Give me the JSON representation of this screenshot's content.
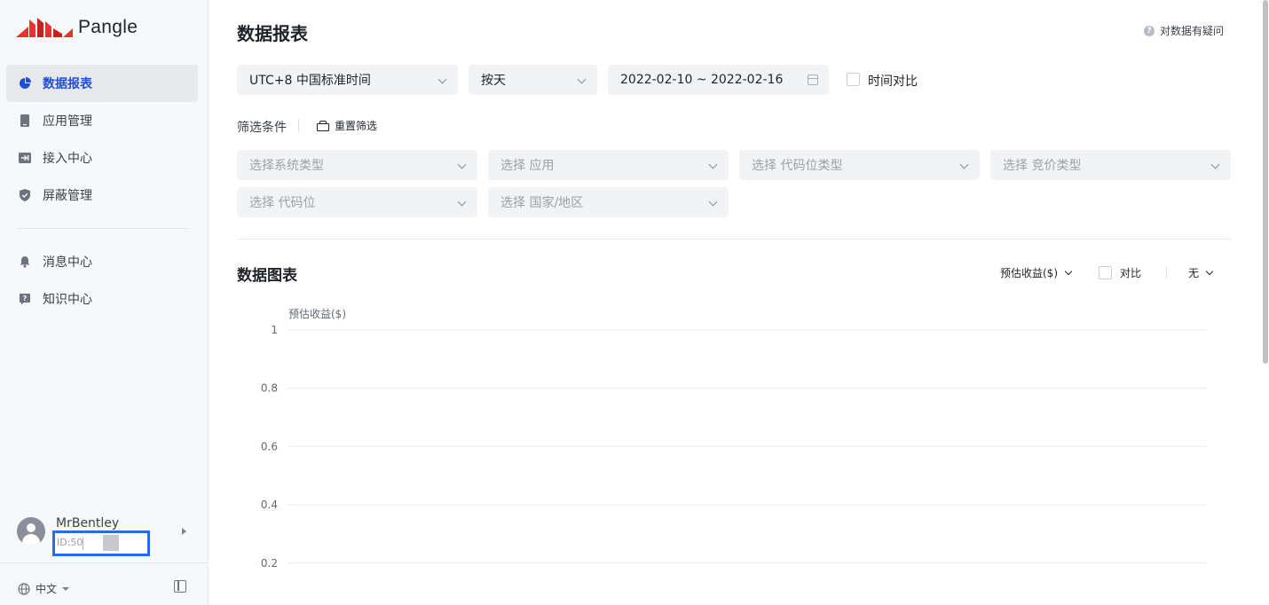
{
  "app": {
    "logo_text": "Pangle"
  },
  "sidebar": {
    "items": [
      {
        "label": "数据报表",
        "icon": "pie-chart-icon",
        "active": true
      },
      {
        "label": "应用管理",
        "icon": "phone-icon",
        "active": false
      },
      {
        "label": "接入中心",
        "icon": "import-icon",
        "active": false
      },
      {
        "label": "屏蔽管理",
        "icon": "shield-icon",
        "active": false
      },
      {
        "label": "消息中心",
        "icon": "bell-icon",
        "active": false
      },
      {
        "label": "知识中心",
        "icon": "question-card-icon",
        "active": false
      }
    ],
    "user": {
      "name": "MrBentley",
      "id_text": "ID:50"
    },
    "language": "中文",
    "highlight_color": "#1e6ff0"
  },
  "header": {
    "title": "数据报表",
    "doubt_link": "对数据有疑问"
  },
  "controls": {
    "timezone": "UTC+8 中国标准时间",
    "granularity": "按天",
    "date_range": "2022-02-10 ~ 2022-02-16",
    "time_compare_label": "时间对比"
  },
  "filters": {
    "label": "筛选条件",
    "reset_label": "重置筛选",
    "placeholders": [
      "选择系统类型",
      "选择 应用",
      "选择 代码位类型",
      "选择 竞价类型",
      "选择 代码位",
      "选择 国家/地区"
    ]
  },
  "chart_section": {
    "title": "数据图表",
    "metric": "预估收益($)",
    "compare_label": "对比",
    "compare_value": "无"
  },
  "chart_data": {
    "type": "line",
    "ylabel": "预估收益($)",
    "yticks": [
      "1",
      "0.8",
      "0.6",
      "0.4",
      "0.2"
    ],
    "series": []
  },
  "colors": {
    "accent": "#1f4fd6",
    "logo_red": "#e8322f"
  }
}
